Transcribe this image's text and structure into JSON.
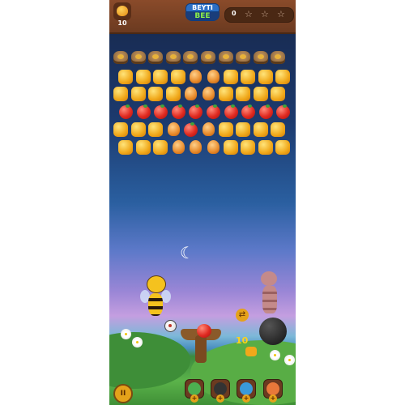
{
  "header": {
    "moves_left": "10",
    "logo_top": "BEYTI",
    "logo_bottom": "BEE",
    "score": "0",
    "stars": [
      "☆",
      "☆",
      "☆"
    ]
  },
  "board": {
    "rows": [
      [
        "blocker",
        "blocker",
        "blocker",
        "blocker",
        "blocker",
        "blocker",
        "blocker",
        "blocker",
        "blocker",
        "blocker"
      ],
      [
        "honey",
        "honey",
        "honey",
        "honey",
        "drum",
        "drum",
        "honey",
        "honey",
        "honey",
        "honey"
      ],
      [
        "honey",
        "honey",
        "honey",
        "honey",
        "drum",
        "drum",
        "honey",
        "honey",
        "honey",
        "honey"
      ],
      [
        "apple",
        "apple",
        "apple",
        "apple",
        "apple",
        "apple",
        "apple",
        "apple",
        "apple",
        "apple"
      ],
      [
        "honey",
        "honey",
        "honey",
        "drum",
        "apple",
        "drum",
        "honey",
        "honey",
        "honey",
        "honey"
      ],
      [
        "honey",
        "honey",
        "honey",
        "drum",
        "drum",
        "drum",
        "honey",
        "honey",
        "honey",
        "honey"
      ]
    ]
  },
  "shooter": {
    "loaded": "apple",
    "next": "honey",
    "shots_left": "10",
    "swap_icon": "swap-arrows-icon"
  },
  "footer": {
    "pause_label": "II",
    "boosters": [
      {
        "name": "booster-leaf",
        "color": "#4caf50"
      },
      {
        "name": "booster-bomb",
        "color": "#333333"
      },
      {
        "name": "booster-arrow",
        "color": "#3a9ad9"
      },
      {
        "name": "booster-swirl",
        "color": "#e8783a"
      }
    ]
  }
}
